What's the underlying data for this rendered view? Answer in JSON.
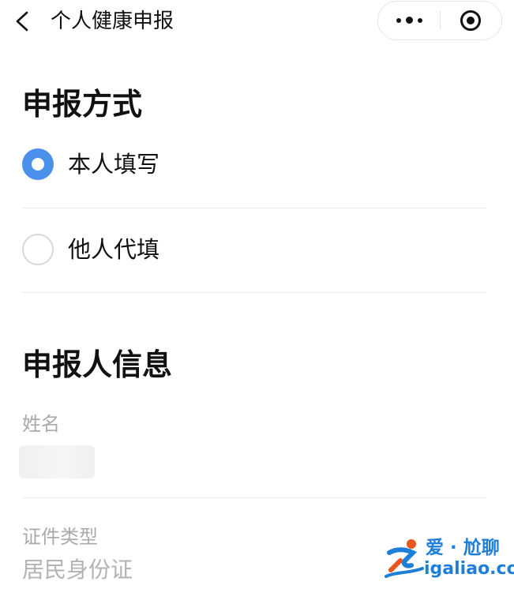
{
  "nav": {
    "title": "个人健康申报",
    "back_icon": "chevron-left-icon",
    "more_icon": "more-dots-icon",
    "close_icon": "target-icon"
  },
  "report_method": {
    "title": "申报方式",
    "options": [
      {
        "label": "本人填写",
        "selected": true
      },
      {
        "label": "他人代填",
        "selected": false
      }
    ]
  },
  "reporter_info": {
    "title": "申报人信息",
    "name": {
      "label": "姓名",
      "value": ""
    },
    "id_type": {
      "label": "证件类型",
      "value": "居民身份证"
    }
  },
  "watermark": {
    "brand": "爱 · 尬聊",
    "url": "igaliao.com"
  },
  "colors": {
    "accent": "#4a90ea",
    "watermark": "#1d7fd8",
    "label_gray": "#aaaaaa"
  }
}
